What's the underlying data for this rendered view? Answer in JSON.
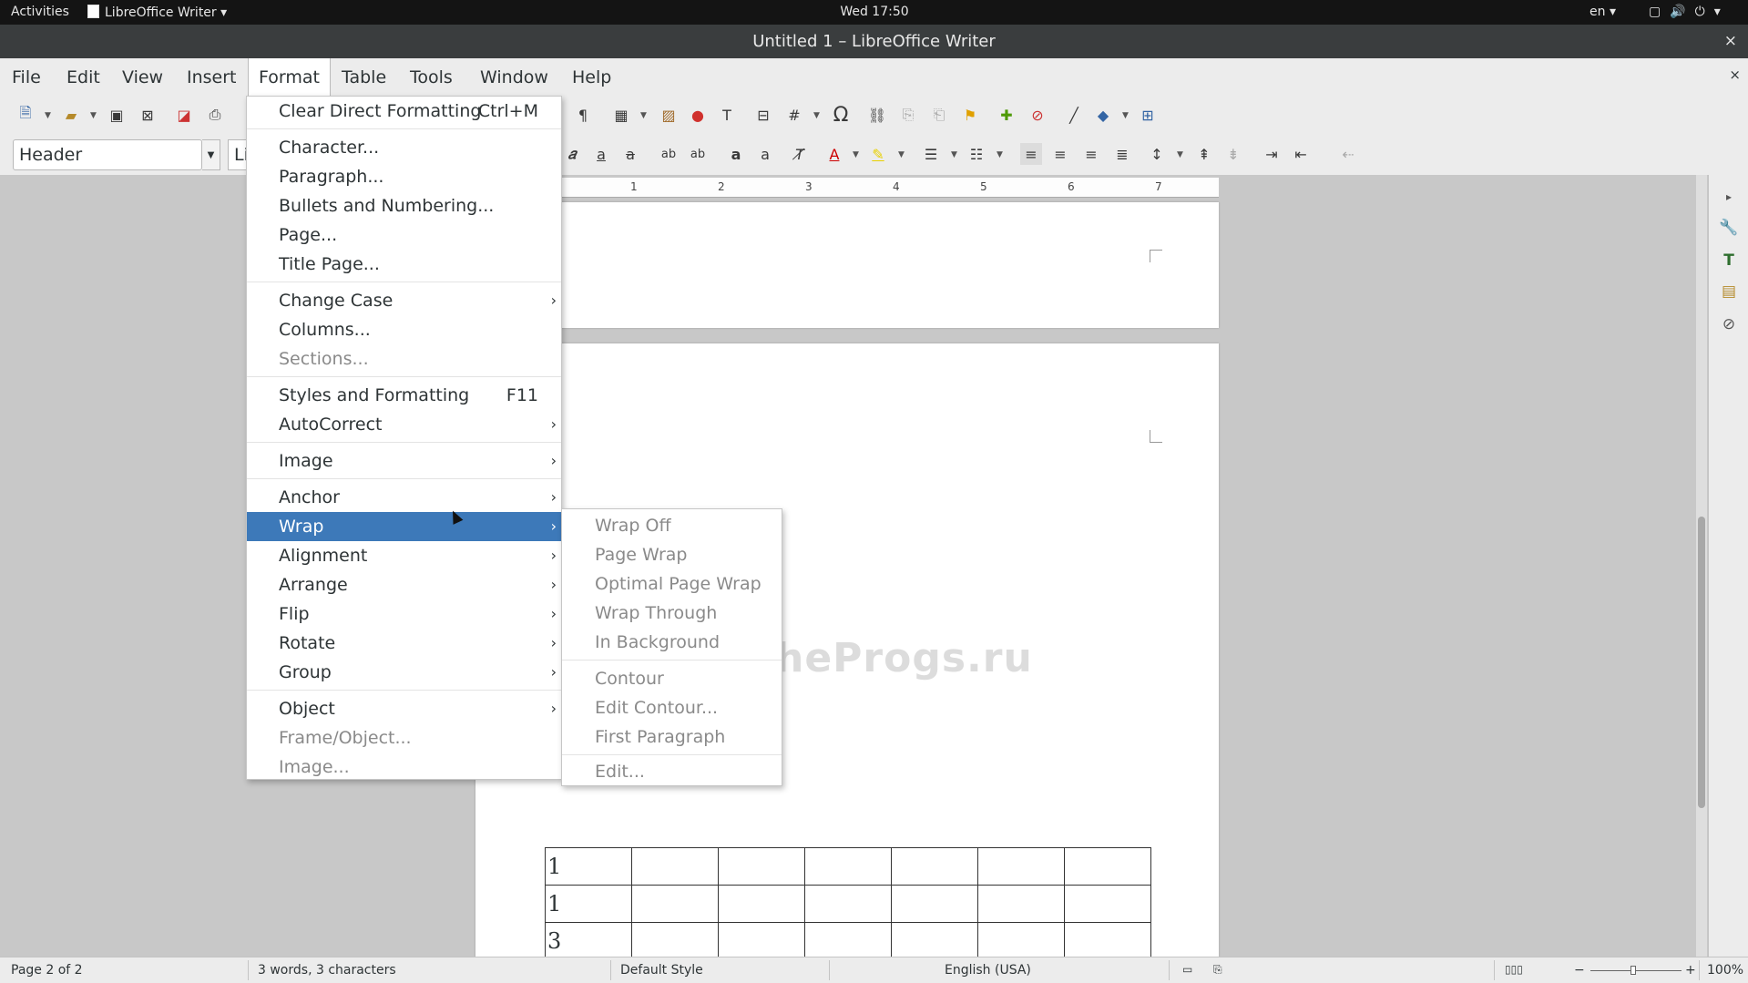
{
  "topbar": {
    "activities": "Activities",
    "app_name": "LibreOffice Writer",
    "app_arrow": "▾",
    "clock": "Wed 17:50",
    "lang": "en",
    "lang_arrow": "▾"
  },
  "window": {
    "title": "Untitled 1 – LibreOffice Writer",
    "close": "×"
  },
  "menubar": {
    "items": [
      "File",
      "Edit",
      "View",
      "Insert",
      "Format",
      "Table",
      "Tools",
      "Window",
      "Help"
    ],
    "close": "×"
  },
  "toolbar": {
    "paragraph_style": "Header",
    "font_name_partial": "Li"
  },
  "ruler": {
    "ticks": [
      "1",
      "2",
      "3",
      "4",
      "5",
      "6",
      "7"
    ]
  },
  "watermark": "TheProgs.ru",
  "table": {
    "rows": [
      [
        "1",
        "",
        "",
        "",
        "",
        "",
        ""
      ],
      [
        "1",
        "",
        "",
        "",
        "",
        "",
        ""
      ],
      [
        "3",
        "",
        "",
        "",
        "",
        "",
        ""
      ]
    ]
  },
  "format_menu": {
    "items": [
      {
        "label": "Clear Direct Formatting",
        "shortcut": "Ctrl+M"
      },
      {
        "label": "Character..."
      },
      {
        "label": "Paragraph..."
      },
      {
        "label": "Bullets and Numbering..."
      },
      {
        "label": "Page..."
      },
      {
        "label": "Title Page..."
      },
      {
        "label": "Change Case",
        "arrow": "›"
      },
      {
        "label": "Columns..."
      },
      {
        "label": "Sections..."
      },
      {
        "label": "Styles and Formatting",
        "shortcut": "F11"
      },
      {
        "label": "AutoCorrect",
        "arrow": "›"
      },
      {
        "label": "Image",
        "arrow": "›"
      },
      {
        "label": "Anchor",
        "arrow": "›"
      },
      {
        "label": "Wrap",
        "arrow": "›"
      },
      {
        "label": "Alignment",
        "arrow": "›"
      },
      {
        "label": "Arrange",
        "arrow": "›"
      },
      {
        "label": "Flip",
        "arrow": "›"
      },
      {
        "label": "Rotate",
        "arrow": "›"
      },
      {
        "label": "Group",
        "arrow": "›"
      },
      {
        "label": "Object",
        "arrow": "›"
      },
      {
        "label": "Frame/Object..."
      },
      {
        "label": "Image..."
      }
    ]
  },
  "wrap_submenu": {
    "items": [
      "Wrap Off",
      "Page Wrap",
      "Optimal Page Wrap",
      "Wrap Through",
      "In Background",
      "Contour",
      "Edit Contour...",
      "First Paragraph",
      "Edit..."
    ]
  },
  "statusbar": {
    "page": "Page 2 of 2",
    "words": "3 words, 3 characters",
    "style": "Default Style",
    "language": "English (USA)",
    "zoom_minus": "−",
    "zoom_plus": "+",
    "zoom": "100%"
  },
  "colors": {
    "highlight": "#3d79b9",
    "menubar": "#ececec",
    "topbar": "#141414"
  }
}
